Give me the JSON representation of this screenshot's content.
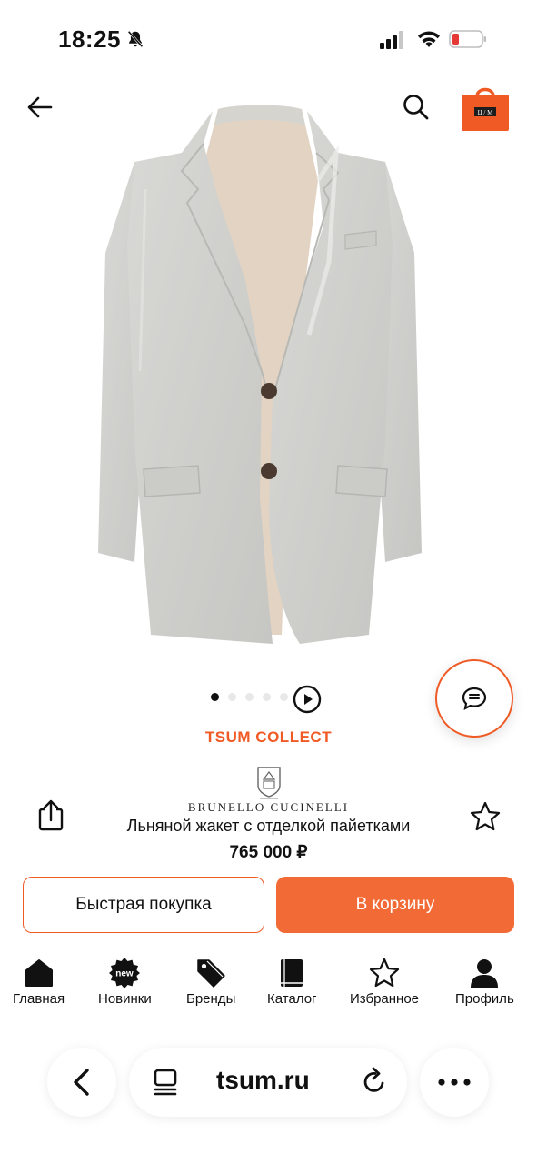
{
  "status_bar": {
    "time": "18:25",
    "icons": [
      "bell-muted-icon",
      "signal-icon",
      "wifi-icon",
      "battery-low-icon"
    ],
    "battery_color": "#e53935"
  },
  "header": {
    "back_icon": "arrow-left-icon",
    "search_icon": "search-icon",
    "bag_icon": "shopping-bag-icon",
    "bag_label": "Ц / М",
    "accent": "#f05a24"
  },
  "gallery": {
    "image_description_icon": "jacket-image",
    "dots_count": 5,
    "active_dot": 1,
    "play_icon": "play-icon"
  },
  "chat": {
    "icon": "chat-icon"
  },
  "product": {
    "collection": "TSUM COLLECT",
    "brand": "BRUNELLO CUCINELLI",
    "title": "Льняной жакет с отделкой пайетками",
    "price": "765 000 ₽",
    "share_icon": "share-icon",
    "favorite_icon": "star-outline-icon"
  },
  "actions": {
    "quick_buy": "Быстрая покупка",
    "add_to_cart": "В корзину"
  },
  "tabs": [
    {
      "label": "Главная",
      "icon": "home-icon"
    },
    {
      "label": "Новинки",
      "icon": "new-badge-icon",
      "badge": "new"
    },
    {
      "label": "Бренды",
      "icon": "tag-icon"
    },
    {
      "label": "Каталог",
      "icon": "book-icon"
    },
    {
      "label": "Избранное",
      "icon": "star-outline-icon"
    },
    {
      "label": "Профиль",
      "icon": "user-icon"
    }
  ],
  "browser": {
    "url": "tsum.ru",
    "icons": [
      "chevron-left-icon",
      "tabs-icon",
      "reload-icon",
      "more-icon"
    ]
  }
}
